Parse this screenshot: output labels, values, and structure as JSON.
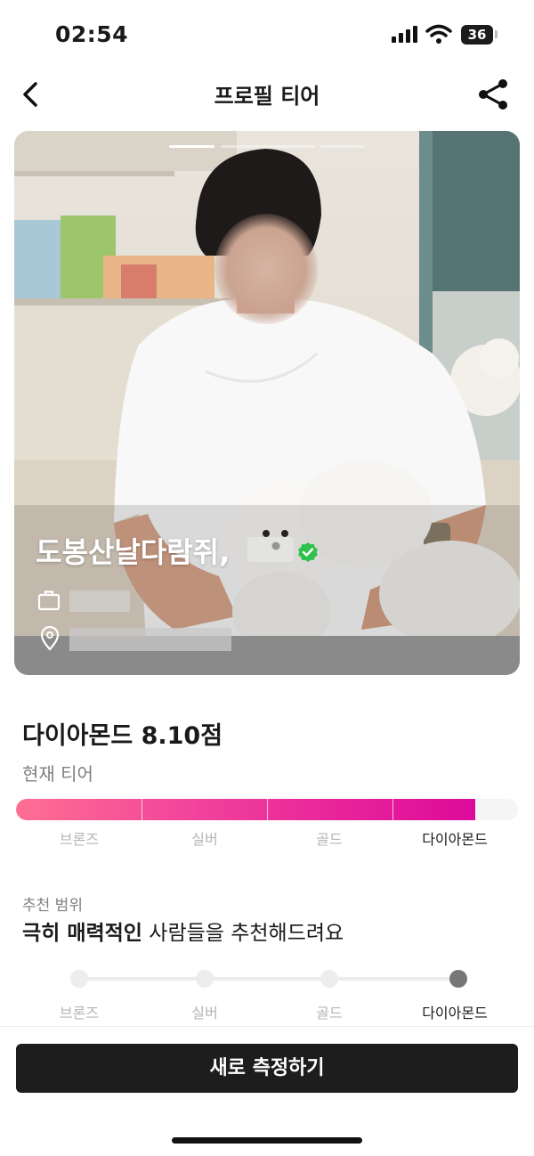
{
  "status_bar": {
    "time": "02:54",
    "battery": "36"
  },
  "header": {
    "title": "프로필 티어",
    "back_icon": "chevron-left-icon",
    "share_icon": "share-icon"
  },
  "profile": {
    "photo_count": 3,
    "active_photo_index": 0,
    "nickname": "도봉산날다람쥐,",
    "verified_icon": "verified-check-icon",
    "verified_color": "#2ec24a",
    "job_icon": "briefcase-icon",
    "location_icon": "location-pin-icon"
  },
  "tier": {
    "score_text": "다이아몬드 8.10점",
    "current_label": "현재 티어",
    "fill_fraction": 0.915,
    "levels": [
      "브론즈",
      "실버",
      "골드",
      "다이아몬드"
    ],
    "current_index": 3,
    "gradient_colors": [
      "#ff6f91",
      "#f2479b",
      "#e8249a",
      "#dc0a9a"
    ]
  },
  "recommend": {
    "label": "추천 범위",
    "text_bold": "극히 매력적인",
    "text_rest": " 사람들을 추천해드려요",
    "levels": [
      "브론즈",
      "실버",
      "골드",
      "다이아몬드"
    ],
    "selected_index": 3
  },
  "cta": {
    "label": "새로 측정하기"
  }
}
